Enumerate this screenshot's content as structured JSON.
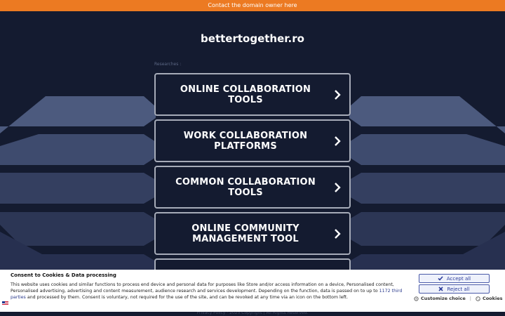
{
  "topbar": {
    "text": "Contact the domain owner here"
  },
  "site": {
    "domain": "bettertogether.ro"
  },
  "researches_label": "Researches :",
  "cards": [
    {
      "label": "ONLINE COLLABORATION TOOLS"
    },
    {
      "label": "WORK COLLABORATION PLATFORMS"
    },
    {
      "label": "COMMON COLLABORATION TOOLS"
    },
    {
      "label": "ONLINE COMMUNITY MANAGEMENT TOOL"
    }
  ],
  "footer": {
    "text": "Privacy Policy · 2025 Copyright | All Rights Reserved."
  },
  "consent": {
    "title": "Consent to Cookies & Data processing",
    "text_before": "This website uses cookies and similar functions to process end device and personal data for purposes like Store and/or access information on a device, Personalised content, Personalised advertising, advertising and content measurement, audience research and services development. Depending on the function, data is passed on to up to ",
    "link": "1172 third parties",
    "text_after": " and processed by them. Consent is voluntary, not required for the use of the site, and can be revoked at any time via an icon on the bottom left.",
    "accept_label": "Accept all",
    "reject_label": "Reject all",
    "customize_label": "Customize choice",
    "cookies_label": "Cookies"
  },
  "colors": {
    "topbar": "#ec7a22",
    "background": "#141b30",
    "card_border": "#a6abb8",
    "button_text": "#2f3f9c"
  },
  "icons": [
    "chevron-right-icon",
    "check-icon",
    "x-icon",
    "gear-icon",
    "cookie-icon",
    "flag-icon"
  ]
}
